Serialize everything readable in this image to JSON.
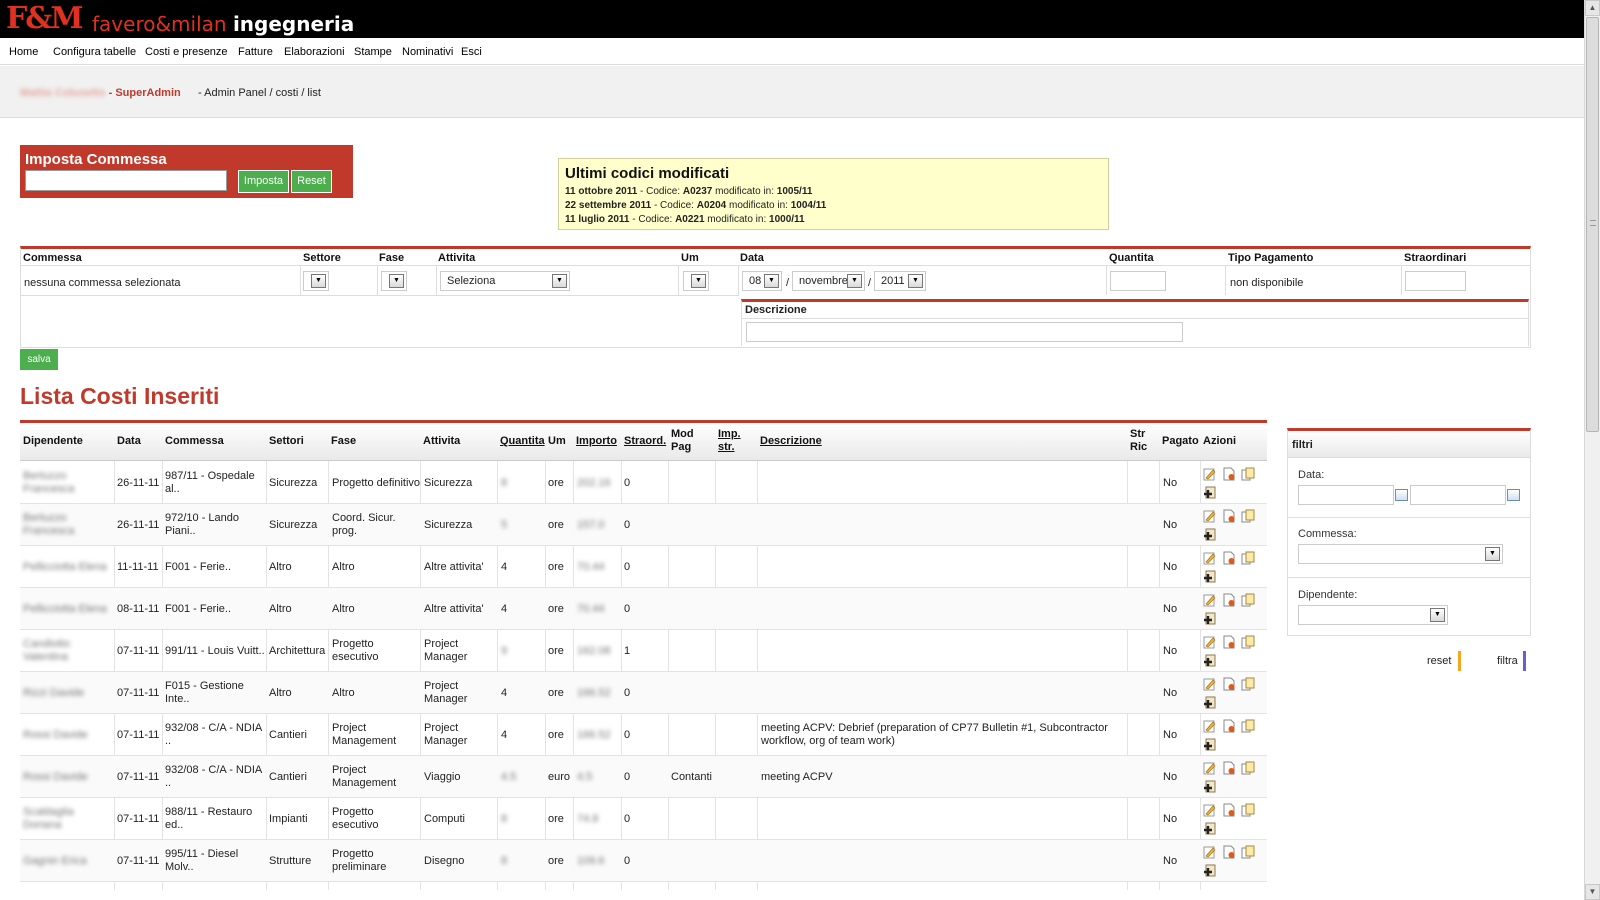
{
  "header": {
    "logo_mark": "F&M",
    "logo_name_red": "favero&milan",
    "logo_name_white": "ingegneria"
  },
  "nav": [
    "Home",
    "Configura tabelle",
    "Costi e presenze",
    "Fatture",
    "Elaborazioni",
    "Stampe",
    "Nominativi",
    "Esci"
  ],
  "breadcrumb": {
    "user_name": "Mattia Colusetto",
    "role": " - SuperAdmin",
    "path": "- Admin Panel / costi / list"
  },
  "imposta": {
    "title": "Imposta Commessa",
    "input_value": "",
    "imposta_label": "Imposta",
    "reset_label": "Reset"
  },
  "ultimi": {
    "title": "Ultimi codici modificati",
    "rows": [
      {
        "date": "11 ottobre 2011",
        "codice_label": " - Codice: ",
        "codice": "A0237",
        "mod_label": " modificato in: ",
        "value": "1005/11"
      },
      {
        "date": "22 settembre 2011",
        "codice_label": " - Codice: ",
        "codice": "A0204",
        "mod_label": " modificato in: ",
        "value": "1004/11"
      },
      {
        "date": "11 luglio 2011",
        "codice_label": " - Codice: ",
        "codice": "A0221",
        "mod_label": " modificato in: ",
        "value": "1000/11"
      }
    ]
  },
  "form": {
    "headers": {
      "commessa": "Commessa",
      "settore": "Settore",
      "fase": "Fase",
      "attivita": "Attivita",
      "um": "Um",
      "data": "Data",
      "quantita": "Quantita",
      "tipo_pagamento": "Tipo Pagamento",
      "straordinari": "Straordinari"
    },
    "commessa_value": "nessuna commessa selezionata",
    "attivita_value": "Seleziona",
    "date_day": "08",
    "date_month": "novembre",
    "date_year": "2011",
    "date_sep": "/",
    "tipo_pagamento_value": "non disponibile",
    "descrizione_label": "Descrizione",
    "salva_label": "salva"
  },
  "lista": {
    "title": "Lista Costi Inseriti",
    "headers": {
      "dipendente": "Dipendente",
      "data": "Data",
      "commessa": "Commessa",
      "settori": "Settori",
      "fase": "Fase",
      "attivita": "Attivita",
      "quantita": "Quantita",
      "um": "Um",
      "importo": "Importo",
      "straord": "Straord.",
      "mod_pag_1": "Mod",
      "mod_pag_2": "Pag",
      "imp_str_1": "Imp.",
      "imp_str_2": "str.",
      "descrizione": "Descrizione",
      "str_ric_1": "Str",
      "str_ric_2": "Ric",
      "pagato": "Pagato",
      "azioni": "Azioni"
    },
    "rows": [
      {
        "dip1": "Bertuzzo",
        "dip2": "Francesca",
        "data": "26-11-11",
        "com1": "987/11 - Ospedale",
        "com2": "al..",
        "settori": "Sicurezza",
        "fase1": "Progetto definitivo",
        "fase2": "",
        "att1": "Sicurezza",
        "att2": "",
        "quantita": "8",
        "um": "ore",
        "importo": "202.16",
        "straord": "0",
        "modpag": "",
        "desc1": "",
        "desc2": "",
        "pagato": "No"
      },
      {
        "dip1": "Bertuzzo",
        "dip2": "Francesca",
        "data": "26-11-11",
        "com1": "972/10 - Lando",
        "com2": "Piani..",
        "settori": "Sicurezza",
        "fase1": "Coord. Sicur.",
        "fase2": "prog.",
        "att1": "Sicurezza",
        "att2": "",
        "quantita": "5",
        "um": "ore",
        "importo": "157.0",
        "straord": "0",
        "modpag": "",
        "desc1": "",
        "desc2": "",
        "pagato": "No"
      },
      {
        "dip1": "Pellicciotta Elena",
        "dip2": "",
        "data": "11-11-11",
        "com1": "F001 - Ferie..",
        "com2": "",
        "settori": "Altro",
        "fase1": "Altro",
        "fase2": "",
        "att1": "Altre attivita'",
        "att2": "",
        "quantita": "4",
        "um": "ore",
        "importo": "70.44",
        "straord": "0",
        "modpag": "",
        "desc1": "",
        "desc2": "",
        "pagato": "No"
      },
      {
        "dip1": "Pellicciotta Elena",
        "dip2": "",
        "data": "08-11-11",
        "com1": "F001 - Ferie..",
        "com2": "",
        "settori": "Altro",
        "fase1": "Altro",
        "fase2": "",
        "att1": "Altre attivita'",
        "att2": "",
        "quantita": "4",
        "um": "ore",
        "importo": "70.44",
        "straord": "0",
        "modpag": "",
        "desc1": "",
        "desc2": "",
        "pagato": "No"
      },
      {
        "dip1": "Candiotto",
        "dip2": "Valentina",
        "data": "07-11-11",
        "com1": "991/11 - Louis Vuitt..",
        "com2": "",
        "settori": "Architettura",
        "fase1": "Progetto",
        "fase2": "esecutivo",
        "att1": "Project",
        "att2": "Manager",
        "quantita": "9",
        "um": "ore",
        "importo": "162.08",
        "straord": "1",
        "modpag": "",
        "desc1": "",
        "desc2": "",
        "pagato": "No"
      },
      {
        "dip1": "Rizzi Davide",
        "dip2": "",
        "data": "07-11-11",
        "com1": "F015 - Gestione",
        "com2": "Inte..",
        "settori": "Altro",
        "fase1": "Altro",
        "fase2": "",
        "att1": "Project",
        "att2": "Manager",
        "quantita": "4",
        "um": "ore",
        "importo": "166.52",
        "straord": "0",
        "modpag": "",
        "desc1": "",
        "desc2": "",
        "pagato": "No"
      },
      {
        "dip1": "Rossi Davide",
        "dip2": "",
        "data": "07-11-11",
        "com1": "932/08 - C/A - NDIA",
        "com2": "..",
        "settori": "Cantieri",
        "fase1": "Project",
        "fase2": "Management",
        "att1": "Project",
        "att2": "Manager",
        "quantita": "4",
        "um": "ore",
        "importo": "166.52",
        "straord": "0",
        "modpag": "",
        "desc1": "meeting ACPV: Debrief (preparation of CP77 Bulletin #1, Subcontractor",
        "desc2": "workflow, org of team work)",
        "pagato": "No"
      },
      {
        "dip1": "Rossi Davide",
        "dip2": "",
        "data": "07-11-11",
        "com1": "932/08 - C/A - NDIA",
        "com2": "..",
        "settori": "Cantieri",
        "fase1": "Project",
        "fase2": "Management",
        "att1": "Viaggio",
        "att2": "",
        "quantita": "4.5",
        "um": "euro",
        "importo": "4.5",
        "straord": "0",
        "modpag": "Contanti",
        "desc1": "meeting ACPV",
        "desc2": "",
        "pagato": "No"
      },
      {
        "dip1": "Scaldaglia",
        "dip2": "Doriana",
        "data": "07-11-11",
        "com1": "988/11 - Restauro",
        "com2": "ed..",
        "settori": "Impianti",
        "fase1": "Progetto",
        "fase2": "esecutivo",
        "att1": "Computi",
        "att2": "",
        "quantita": "8",
        "um": "ore",
        "importo": "74.8",
        "straord": "0",
        "modpag": "",
        "desc1": "",
        "desc2": "",
        "pagato": "No"
      },
      {
        "dip1": "Gagnin Erica",
        "dip2": "",
        "data": "07-11-11",
        "com1": "995/11 - Diesel",
        "com2": "Molv..",
        "settori": "Strutture",
        "fase1": "Progetto",
        "fase2": "preliminare",
        "att1": "Disegno",
        "att2": "",
        "quantita": "8",
        "um": "ore",
        "importo": "109.6",
        "straord": "0",
        "modpag": "",
        "desc1": "",
        "desc2": "",
        "pagato": "No"
      }
    ]
  },
  "filtri": {
    "title": "filtri",
    "data_label": "Data:",
    "commessa_label": "Commessa:",
    "dipendente_label": "Dipendente:",
    "reset_label": "reset",
    "filtra_label": "filtra"
  },
  "colors": {
    "brand_red": "#c0392b",
    "button_green": "#4cae4c",
    "note_yellow": "#ffffcc",
    "reset_bar": "#f5a623",
    "filtra_bar": "#6b5bd6"
  }
}
